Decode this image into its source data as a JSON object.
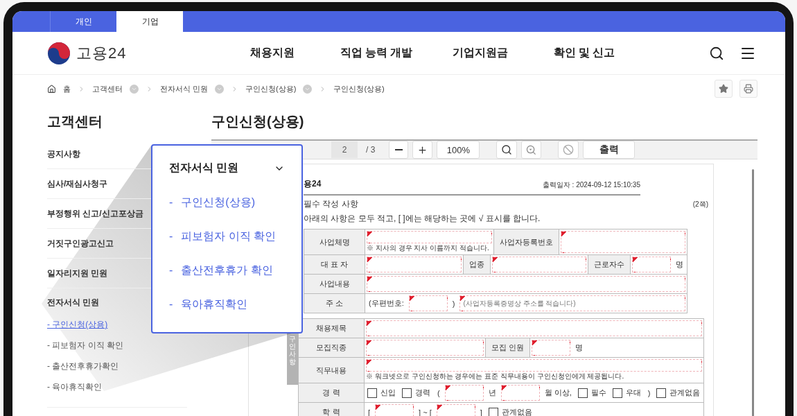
{
  "top_tabs": [
    {
      "label": "개인",
      "selected": false
    },
    {
      "label": "기업",
      "selected": true
    }
  ],
  "header": {
    "logo_text": "고용24",
    "nav": [
      "채용지원",
      "직업 능력 개발",
      "기업지원금",
      "확인 및 신고"
    ]
  },
  "breadcrumb": [
    {
      "label": "홈",
      "kind": "home"
    },
    {
      "label": "고객센터",
      "kind": "menu"
    },
    {
      "label": "전자서식 민원",
      "kind": "menu"
    },
    {
      "label": "구인신청(상용)",
      "kind": "menu"
    },
    {
      "label": "구인신청(상용)",
      "kind": "current"
    }
  ],
  "sidebar": {
    "title": "고객센터",
    "items": [
      {
        "label": "공지사항"
      },
      {
        "label": "심사/재심사청구"
      },
      {
        "label": "부정행위 신고/신고포상금"
      },
      {
        "label": "거짓구인광고신고"
      },
      {
        "label": "일자리지원 민원"
      },
      {
        "label": "전자서식 민원",
        "children": [
          {
            "label": "- 구인신청(상용)",
            "selected": true
          },
          {
            "label": "- 피보험자 이직 확인",
            "selected": false
          },
          {
            "label": "- 출산전후휴가확인",
            "selected": false
          },
          {
            "label": "- 육아휴직확인",
            "selected": false
          }
        ]
      }
    ]
  },
  "page_title": "구인신청(상용)",
  "popover": {
    "title": "전자서식 민원",
    "items": [
      {
        "bullet": "-",
        "label": "구인신청(상용)"
      },
      {
        "bullet": "-",
        "label": "피보험자 이직 확인"
      },
      {
        "bullet": "-",
        "label": "출산전후휴가 확인"
      },
      {
        "bullet": "-",
        "label": "육아휴직확인"
      }
    ]
  },
  "viewer": {
    "page": "2",
    "page_total": "/ 3",
    "zoom": "100%",
    "print_label": "출력"
  },
  "document": {
    "brand": "용24",
    "printed_at": "출력일자 : 2024-09-12 15:10:35",
    "section": "필수 작성 사항",
    "page_note": "(2쪽)",
    "instruction": "아래의 사항은 모두 적고, [ ]에는 해당하는 곳에 √ 표시를 합니다.",
    "sections": [
      {
        "lines": [
          {
            "label": "사업체명",
            "parts": [
              {
                "kind": "input",
                "note": "※ 지사의 경우 지사 이름까지 적습니다."
              },
              {
                "kind": "sublabel",
                "text": "사업자등록번호"
              },
              {
                "kind": "input"
              }
            ]
          },
          {
            "label": "대 표 자",
            "parts": [
              {
                "kind": "input"
              },
              {
                "kind": "sublabel",
                "text": "업종"
              },
              {
                "kind": "input"
              },
              {
                "kind": "sublabel",
                "text": "근로자수"
              },
              {
                "kind": "blank"
              },
              {
                "kind": "text",
                "text": "명"
              }
            ]
          },
          {
            "label": "사업내용",
            "parts": [
              {
                "kind": "input"
              }
            ]
          },
          {
            "label": "주 소",
            "parts": [
              {
                "kind": "text",
                "text": "(우편번호:"
              },
              {
                "kind": "blank"
              },
              {
                "kind": "text",
                "text": ")"
              },
              {
                "kind": "input",
                "placeholder": "(사업자등록증명상 주소를 적습니다)"
              }
            ]
          }
        ]
      },
      {
        "side_label": "구인사항",
        "lines": [
          {
            "label": "채용제목",
            "parts": [
              {
                "kind": "input"
              }
            ]
          },
          {
            "label": "모집직종",
            "parts": [
              {
                "kind": "input"
              },
              {
                "kind": "sublabel",
                "text": "모집 인원"
              },
              {
                "kind": "blank"
              },
              {
                "kind": "text",
                "text": "명"
              },
              {
                "kind": "spacer"
              }
            ]
          },
          {
            "label": "직무내용",
            "parts": [
              {
                "kind": "input",
                "note": "※ 워크넷으로 구인신청하는 경우에는 표준 직무내용이 구인신청인에게 제공됩니다."
              }
            ]
          },
          {
            "label": "경 력",
            "parts": [
              {
                "kind": "checkbox",
                "label": "신입",
                "checked": false
              },
              {
                "kind": "checkbox",
                "label": "경력",
                "checked": false
              },
              {
                "kind": "text",
                "text": "("
              },
              {
                "kind": "blank"
              },
              {
                "kind": "text",
                "text": "년"
              },
              {
                "kind": "blank"
              },
              {
                "kind": "text",
                "text": "월 이상,"
              },
              {
                "kind": "checkbox",
                "label": "필수",
                "checked": false
              },
              {
                "kind": "checkbox",
                "label": "우대",
                "checked": false
              },
              {
                "kind": "text",
                "text": ")"
              },
              {
                "kind": "checkbox",
                "label": "관계없음",
                "checked": false
              }
            ]
          },
          {
            "label": "학 력",
            "parts": [
              {
                "kind": "text",
                "text": "["
              },
              {
                "kind": "blank"
              },
              {
                "kind": "text",
                "text": "] ~ ["
              },
              {
                "kind": "blank"
              },
              {
                "kind": "text",
                "text": "]"
              },
              {
                "kind": "checkbox",
                "label": "관계없음",
                "checked": false
              }
            ]
          }
        ]
      }
    ]
  }
}
